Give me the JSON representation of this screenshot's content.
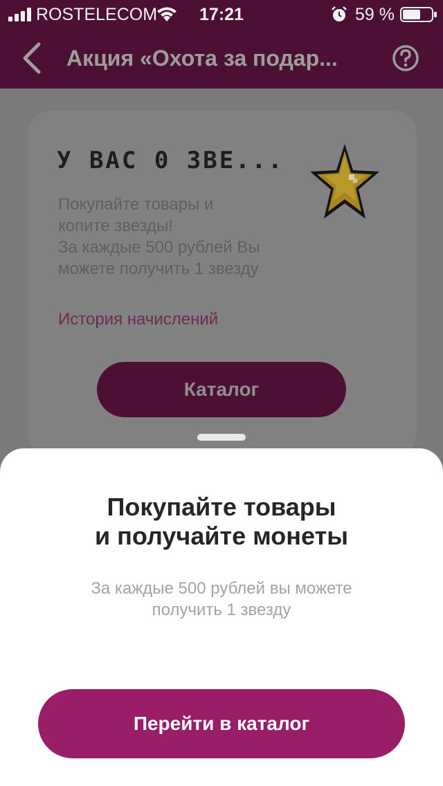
{
  "status_bar": {
    "carrier": "ROSTELECOM",
    "time": "17:21",
    "battery": "59 %",
    "icons": [
      "signal-icon",
      "wifi-icon",
      "alarm-icon",
      "battery-icon"
    ]
  },
  "nav": {
    "title": "Акция «Охота за подар...",
    "back_icon": "chevron-left-icon",
    "help_icon": "question-icon"
  },
  "card": {
    "headline": "У ВАС 0 ЗВЕ...",
    "star_icon": "pixel-star-icon",
    "description_lines": [
      "Покупайте товары и",
      "копите звезды!",
      "За каждые 500 рублей Вы",
      "можете получить 1 звезду"
    ],
    "history_link": "История начислений",
    "catalog_button": "Каталог"
  },
  "sheet": {
    "title_lines": [
      "Покупайте товары",
      "и получайте монеты"
    ],
    "subtitle_lines": [
      "За каждые 500 рублей вы можете",
      "получить 1 звезду"
    ],
    "button": "Перейти в каталог"
  },
  "colors": {
    "brand_dark": "#4b1033",
    "brand_button": "#9a1d68",
    "overlay": "#7a7a7a",
    "sheet_bg": "#ffffff"
  }
}
